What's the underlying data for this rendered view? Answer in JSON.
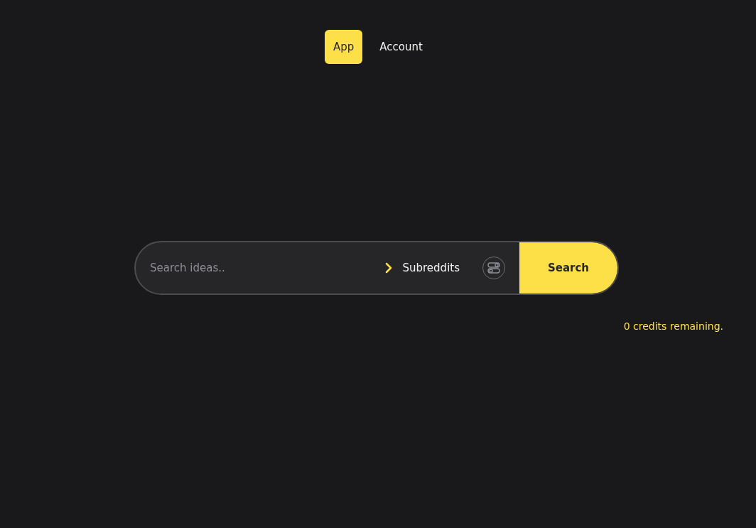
{
  "nav": {
    "tabs": [
      {
        "label": "App",
        "selected": true
      },
      {
        "label": "Account",
        "selected": false
      }
    ]
  },
  "search": {
    "placeholder": "Search ideas..",
    "source_label": "Subreddits",
    "button": "Search"
  },
  "credits": "0 credits remaining."
}
